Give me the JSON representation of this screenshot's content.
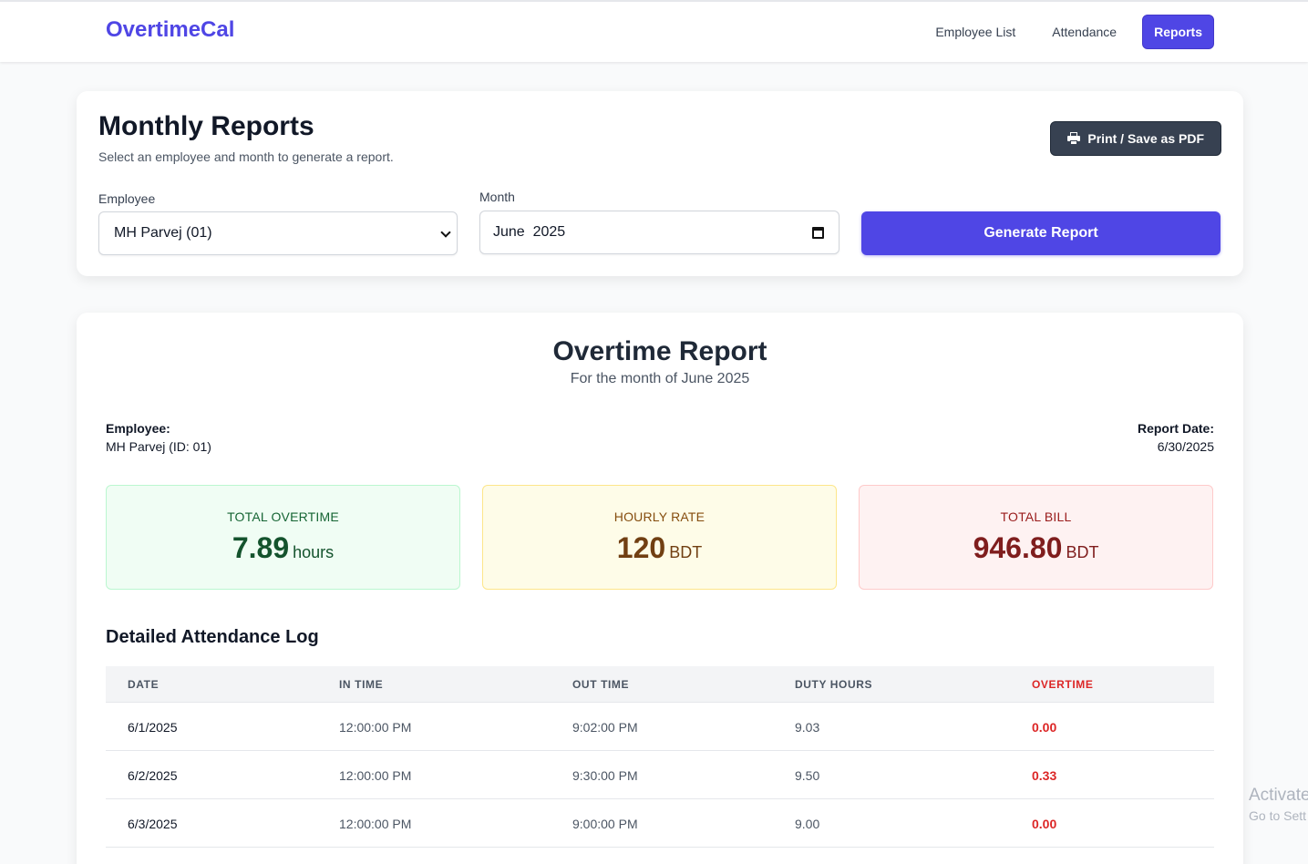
{
  "nav": {
    "brand": "OvertimeCal",
    "links": [
      "Employee List",
      "Attendance",
      "Reports"
    ]
  },
  "form_card": {
    "title": "Monthly Reports",
    "subtitle": "Select an employee and month to generate a report.",
    "print_label": "Print / Save as PDF",
    "employee_label": "Employee",
    "employee_value": "MH Parvej (01)",
    "month_label": "Month",
    "month_value": "June  2025",
    "generate_label": "Generate Report"
  },
  "report": {
    "title": "Overtime Report",
    "subtitle": "For the month of June 2025",
    "employee_label": "Employee:",
    "employee_value": "MH Parvej (ID: 01)",
    "date_label": "Report Date:",
    "date_value": "6/30/2025",
    "stats": {
      "overtime": {
        "label": "TOTAL OVERTIME",
        "value": "7.89",
        "unit": "hours"
      },
      "rate": {
        "label": "HOURLY RATE",
        "value": "120",
        "unit": "BDT"
      },
      "bill": {
        "label": "TOTAL BILL",
        "value": "946.80",
        "unit": "BDT"
      }
    },
    "log_title": "Detailed Attendance Log",
    "columns": [
      "DATE",
      "IN TIME",
      "OUT TIME",
      "DUTY HOURS",
      "OVERTIME"
    ],
    "rows": [
      {
        "date": "6/1/2025",
        "in": "12:00:00 PM",
        "out": "9:02:00 PM",
        "duty": "9.03",
        "ot": "0.00"
      },
      {
        "date": "6/2/2025",
        "in": "12:00:00 PM",
        "out": "9:30:00 PM",
        "duty": "9.50",
        "ot": "0.33"
      },
      {
        "date": "6/3/2025",
        "in": "12:00:00 PM",
        "out": "9:00:00 PM",
        "duty": "9.00",
        "ot": "0.00"
      }
    ]
  },
  "watermark": {
    "line1": "Activate",
    "line2": "Go to Sett"
  },
  "colors": {
    "accent": "#4f46e5",
    "overtime": "#dc2626",
    "dark_button": "#374151"
  }
}
